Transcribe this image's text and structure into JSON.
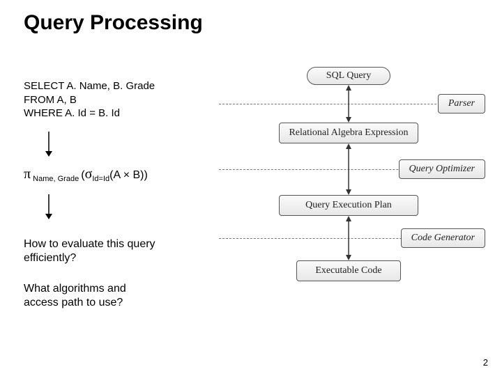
{
  "title": "Query Processing",
  "sql": {
    "line1": "SELECT A. Name, B. Grade",
    "line2": "FROM A, B",
    "line3": "WHERE A. Id = B. Id"
  },
  "ra": {
    "pi": "π",
    "pi_sub": " Name, Grade ",
    "open": "(",
    "sigma": "σ",
    "sigma_sub": "Id=Id",
    "inner": "(A × B))"
  },
  "questions": {
    "q1a": "How to evaluate this query",
    "q1b": "efficiently?",
    "q2a": "What algorithms and",
    "q2b": "access path to use?"
  },
  "flow": {
    "stages": {
      "s0": "SQL Query",
      "s1": "Relational Algebra Expression",
      "s2": "Query Execution Plan",
      "s3": "Executable Code"
    },
    "phases": {
      "p0": "Parser",
      "p1": "Query Optimizer",
      "p2": "Code Generator"
    }
  },
  "page_number": "2"
}
